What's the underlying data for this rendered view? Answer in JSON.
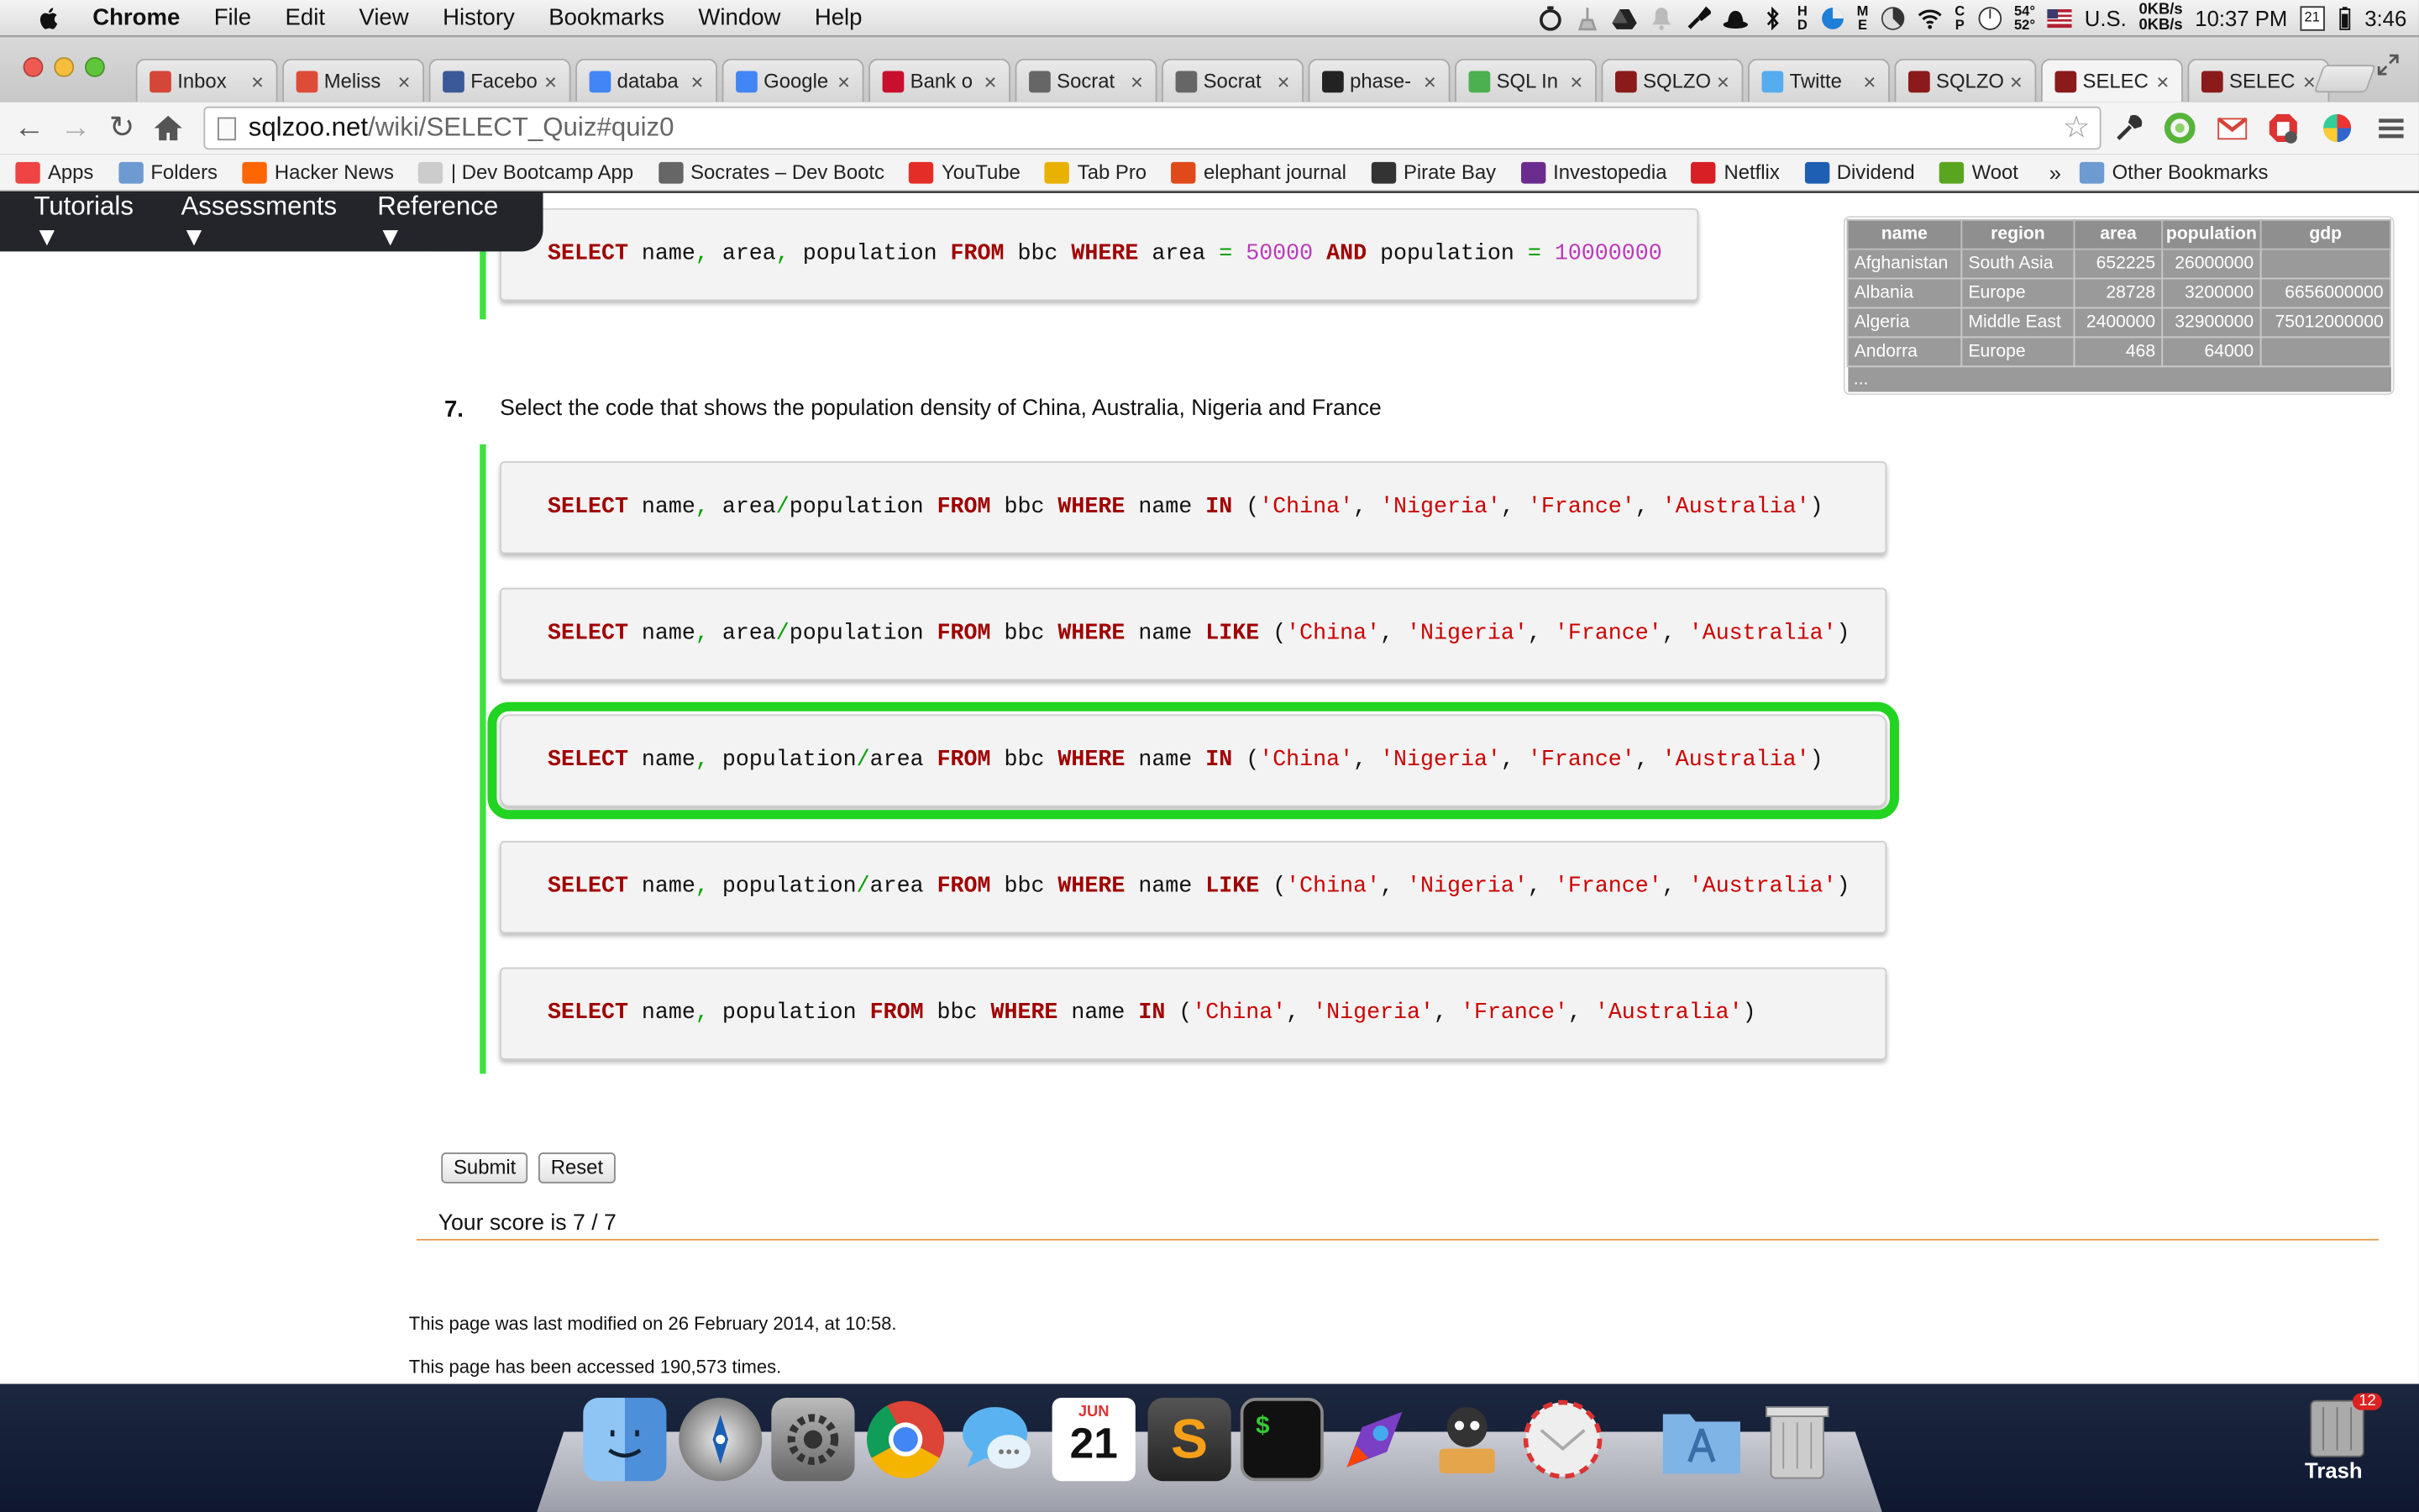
{
  "menubar": {
    "app": "Chrome",
    "items": [
      "File",
      "Edit",
      "View",
      "History",
      "Bookmarks",
      "Window",
      "Help"
    ],
    "weather_hi": "54°",
    "weather_lo": "52°",
    "input_source": "U.S.",
    "net_up": "0KB/s",
    "net_down": "0KB/s",
    "time": "10:37 PM",
    "calendar_day": "21",
    "battery_time": "3:46"
  },
  "tabs": [
    {
      "label": "Inbox",
      "icon": "gmail-icon",
      "color": "#d44638"
    },
    {
      "label": "Meliss",
      "icon": "google-plus-icon",
      "color": "#dd4b39"
    },
    {
      "label": "Facebo",
      "icon": "facebook-icon",
      "color": "#3b5998"
    },
    {
      "label": "databa",
      "icon": "google-search-icon",
      "color": "#4285f4"
    },
    {
      "label": "Google",
      "icon": "google-calendar-icon",
      "color": "#4285f4"
    },
    {
      "label": "Bank o",
      "icon": "bank-icon",
      "color": "#c8102e"
    },
    {
      "label": "Socrat",
      "icon": "socrates-icon",
      "color": "#666666"
    },
    {
      "label": "Socrat",
      "icon": "socrates-icon",
      "color": "#666666"
    },
    {
      "label": "phase-",
      "icon": "github-icon",
      "color": "#222222"
    },
    {
      "label": "SQL In",
      "icon": "w3schools-icon",
      "color": "#4caf50"
    },
    {
      "label": "SQLZO",
      "icon": "sqlzoo-icon",
      "color": "#8b1a1a"
    },
    {
      "label": "Twitte",
      "icon": "twitter-icon",
      "color": "#55acee"
    },
    {
      "label": "SQLZO",
      "icon": "sqlzoo-icon",
      "color": "#8b1a1a"
    },
    {
      "label": "SELEC",
      "icon": "sqlzoo-icon",
      "color": "#8b1a1a",
      "active": true
    },
    {
      "label": "SELEC",
      "icon": "sqlzoo-icon",
      "color": "#8b1a1a"
    }
  ],
  "address": {
    "host": "sqlzoo.net",
    "path": "/wiki/SELECT_Quiz#quiz0"
  },
  "bookmarks": [
    {
      "label": "Apps",
      "icon": "apps-grid-icon",
      "color": "#e44"
    },
    {
      "label": "Folders",
      "icon": "folder-icon",
      "color": "#6d9bd1"
    },
    {
      "label": "Hacker News",
      "icon": "hacker-news-icon",
      "color": "#ff6600"
    },
    {
      "label": "| Dev Bootcamp App",
      "icon": "page-icon",
      "color": "#cccccc"
    },
    {
      "label": "Socrates – Dev Bootc",
      "icon": "socrates-icon",
      "color": "#666666"
    },
    {
      "label": "YouTube",
      "icon": "youtube-icon",
      "color": "#e52d27"
    },
    {
      "label": "Tab Pro",
      "icon": "tab-pro-icon",
      "color": "#e9b100"
    },
    {
      "label": "elephant journal",
      "icon": "elephant-journal-icon",
      "color": "#e04a1a"
    },
    {
      "label": "Pirate Bay",
      "icon": "pirate-bay-icon",
      "color": "#333333"
    },
    {
      "label": "Investopedia",
      "icon": "investopedia-icon",
      "color": "#6a2d8f"
    },
    {
      "label": "Netflix",
      "icon": "netflix-icon",
      "color": "#d81f26"
    },
    {
      "label": "Dividend",
      "icon": "dividend-icon",
      "color": "#1e5fb4"
    },
    {
      "label": "Woot",
      "icon": "woot-icon",
      "color": "#5aa51f"
    }
  ],
  "bookmarks_more": "»",
  "bookmarks_other": "Other Bookmarks",
  "nav": {
    "items": [
      "Tutorials ▼",
      "Assessments ▼",
      "Reference ▼"
    ]
  },
  "previous_answer": {
    "parts": [
      {
        "t": "SELECT",
        "c": "kw"
      },
      {
        "t": " name",
        "c": ""
      },
      {
        "t": ",",
        "c": "op"
      },
      {
        "t": " area",
        "c": ""
      },
      {
        "t": ",",
        "c": "op"
      },
      {
        "t": " population ",
        "c": ""
      },
      {
        "t": "FROM",
        "c": "kw"
      },
      {
        "t": " bbc ",
        "c": ""
      },
      {
        "t": "WHERE",
        "c": "kw"
      },
      {
        "t": " area ",
        "c": ""
      },
      {
        "t": "=",
        "c": "op"
      },
      {
        "t": " 50000 ",
        "c": "num"
      },
      {
        "t": "AND",
        "c": "kw"
      },
      {
        "t": " population ",
        "c": ""
      },
      {
        "t": "=",
        "c": "op"
      },
      {
        "t": " 10000000",
        "c": "num"
      }
    ]
  },
  "question": {
    "number": "7.",
    "text": "Select the code that shows the population density of China, Australia, Nigeria and France",
    "answers": [
      {
        "correct": false,
        "parts": [
          {
            "t": "SELECT",
            "c": "kw"
          },
          {
            "t": " name",
            "c": ""
          },
          {
            "t": ",",
            "c": "op"
          },
          {
            "t": " area",
            "c": ""
          },
          {
            "t": "/",
            "c": "op"
          },
          {
            "t": "population ",
            "c": ""
          },
          {
            "t": "FROM",
            "c": "kw"
          },
          {
            "t": " bbc ",
            "c": ""
          },
          {
            "t": "WHERE",
            "c": "kw"
          },
          {
            "t": " name ",
            "c": ""
          },
          {
            "t": "IN",
            "c": "kw"
          },
          {
            "t": " (",
            "c": ""
          },
          {
            "t": "'China'",
            "c": "str"
          },
          {
            "t": ", ",
            "c": ""
          },
          {
            "t": "'Nigeria'",
            "c": "str"
          },
          {
            "t": ", ",
            "c": ""
          },
          {
            "t": "'France'",
            "c": "str"
          },
          {
            "t": ", ",
            "c": ""
          },
          {
            "t": "'Australia'",
            "c": "str"
          },
          {
            "t": ")",
            "c": ""
          }
        ]
      },
      {
        "correct": false,
        "parts": [
          {
            "t": "SELECT",
            "c": "kw"
          },
          {
            "t": " name",
            "c": ""
          },
          {
            "t": ",",
            "c": "op"
          },
          {
            "t": " area",
            "c": ""
          },
          {
            "t": "/",
            "c": "op"
          },
          {
            "t": "population ",
            "c": ""
          },
          {
            "t": "FROM",
            "c": "kw"
          },
          {
            "t": " bbc ",
            "c": ""
          },
          {
            "t": "WHERE",
            "c": "kw"
          },
          {
            "t": " name ",
            "c": ""
          },
          {
            "t": "LIKE",
            "c": "kw"
          },
          {
            "t": " (",
            "c": ""
          },
          {
            "t": "'China'",
            "c": "str"
          },
          {
            "t": ", ",
            "c": ""
          },
          {
            "t": "'Nigeria'",
            "c": "str"
          },
          {
            "t": ", ",
            "c": ""
          },
          {
            "t": "'France'",
            "c": "str"
          },
          {
            "t": ", ",
            "c": ""
          },
          {
            "t": "'Australia'",
            "c": "str"
          },
          {
            "t": ")",
            "c": ""
          }
        ]
      },
      {
        "correct": true,
        "parts": [
          {
            "t": "SELECT",
            "c": "kw"
          },
          {
            "t": " name",
            "c": ""
          },
          {
            "t": ",",
            "c": "op"
          },
          {
            "t": " population",
            "c": ""
          },
          {
            "t": "/",
            "c": "op"
          },
          {
            "t": "area ",
            "c": ""
          },
          {
            "t": "FROM",
            "c": "kw"
          },
          {
            "t": " bbc ",
            "c": ""
          },
          {
            "t": "WHERE",
            "c": "kw"
          },
          {
            "t": " name ",
            "c": ""
          },
          {
            "t": "IN",
            "c": "kw"
          },
          {
            "t": " (",
            "c": ""
          },
          {
            "t": "'China'",
            "c": "str"
          },
          {
            "t": ", ",
            "c": ""
          },
          {
            "t": "'Nigeria'",
            "c": "str"
          },
          {
            "t": ", ",
            "c": ""
          },
          {
            "t": "'France'",
            "c": "str"
          },
          {
            "t": ", ",
            "c": ""
          },
          {
            "t": "'Australia'",
            "c": "str"
          },
          {
            "t": ")",
            "c": ""
          }
        ]
      },
      {
        "correct": false,
        "parts": [
          {
            "t": "SELECT",
            "c": "kw"
          },
          {
            "t": " name",
            "c": ""
          },
          {
            "t": ",",
            "c": "op"
          },
          {
            "t": " population",
            "c": ""
          },
          {
            "t": "/",
            "c": "op"
          },
          {
            "t": "area ",
            "c": ""
          },
          {
            "t": "FROM",
            "c": "kw"
          },
          {
            "t": " bbc ",
            "c": ""
          },
          {
            "t": "WHERE",
            "c": "kw"
          },
          {
            "t": " name ",
            "c": ""
          },
          {
            "t": "LIKE",
            "c": "kw"
          },
          {
            "t": " (",
            "c": ""
          },
          {
            "t": "'China'",
            "c": "str"
          },
          {
            "t": ", ",
            "c": ""
          },
          {
            "t": "'Nigeria'",
            "c": "str"
          },
          {
            "t": ", ",
            "c": ""
          },
          {
            "t": "'France'",
            "c": "str"
          },
          {
            "t": ", ",
            "c": ""
          },
          {
            "t": "'Australia'",
            "c": "str"
          },
          {
            "t": ")",
            "c": ""
          }
        ]
      },
      {
        "correct": false,
        "parts": [
          {
            "t": "SELECT",
            "c": "kw"
          },
          {
            "t": " name",
            "c": ""
          },
          {
            "t": ",",
            "c": "op"
          },
          {
            "t": " population ",
            "c": ""
          },
          {
            "t": "FROM",
            "c": "kw"
          },
          {
            "t": " bbc ",
            "c": ""
          },
          {
            "t": "WHERE",
            "c": "kw"
          },
          {
            "t": " name ",
            "c": ""
          },
          {
            "t": "IN",
            "c": "kw"
          },
          {
            "t": " (",
            "c": ""
          },
          {
            "t": "'China'",
            "c": "str"
          },
          {
            "t": ", ",
            "c": ""
          },
          {
            "t": "'Nigeria'",
            "c": "str"
          },
          {
            "t": ", ",
            "c": ""
          },
          {
            "t": "'France'",
            "c": "str"
          },
          {
            "t": ", ",
            "c": ""
          },
          {
            "t": "'Australia'",
            "c": "str"
          },
          {
            "t": ")",
            "c": ""
          }
        ]
      }
    ]
  },
  "buttons": {
    "submit": "Submit",
    "reset": "Reset"
  },
  "score": "Your score is 7 / 7",
  "footer": {
    "modified": "This page was last modified on 26 February 2014, at 10:58.",
    "accessed": "This page has been accessed 190,573 times."
  },
  "sample_table": {
    "headers": [
      "name",
      "region",
      "area",
      "population",
      "gdp"
    ],
    "rows": [
      [
        "Afghanistan",
        "South Asia",
        "652225",
        "26000000",
        ""
      ],
      [
        "Albania",
        "Europe",
        "28728",
        "3200000",
        "6656000000"
      ],
      [
        "Algeria",
        "Middle East",
        "2400000",
        "32900000",
        "75012000000"
      ],
      [
        "Andorra",
        "Europe",
        "468",
        "64000",
        ""
      ]
    ],
    "ellipsis": "..."
  },
  "dock": {
    "trash_label": "Trash",
    "trash_badge": "12",
    "calendar_month": "JUN",
    "calendar_day": "21",
    "terminal_prompt": "$"
  },
  "colors": {
    "correct_outline": "#22d422",
    "green_bar": "#3ce33c",
    "keyword": "#a00000",
    "string": "#cc0000",
    "number": "#b93ab9"
  }
}
